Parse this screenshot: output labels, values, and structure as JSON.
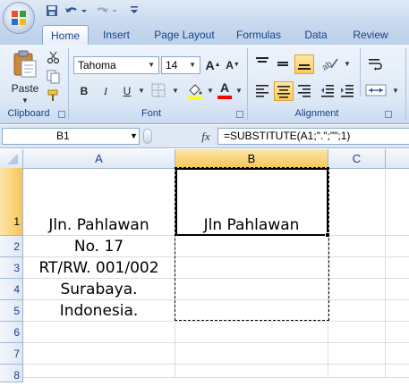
{
  "qat": {
    "save_icon": "save-icon",
    "undo_icon": "undo-icon",
    "redo_icon": "redo-icon"
  },
  "tabs": [
    {
      "label": "Home",
      "active": true
    },
    {
      "label": "Insert",
      "active": false
    },
    {
      "label": "Page Layout",
      "active": false
    },
    {
      "label": "Formulas",
      "active": false
    },
    {
      "label": "Data",
      "active": false
    },
    {
      "label": "Review",
      "active": false
    }
  ],
  "ribbon": {
    "clipboard": {
      "paste_label": "Paste",
      "group_label": "Clipboard"
    },
    "font": {
      "font_name": "Tahoma",
      "font_size": "14",
      "grow_label": "A",
      "shrink_label": "A",
      "bold": "B",
      "italic": "I",
      "underline": "U",
      "font_color_label": "A",
      "group_label": "Font",
      "fill_color": "#ffff00",
      "font_color": "#ff0000"
    },
    "alignment": {
      "group_label": "Alignment"
    }
  },
  "formula_bar": {
    "name_box": "B1",
    "fx_label": "fx",
    "formula": "=SUBSTITUTE(A1;\".\";\"\";1)"
  },
  "grid": {
    "columns": [
      "A",
      "B",
      "C"
    ],
    "selected_column": "B",
    "rows": [
      "1",
      "2",
      "3",
      "4",
      "5",
      "6",
      "7",
      "8"
    ],
    "selected_row": "1",
    "cells": {
      "A1": "Jln. Pahlawan",
      "A2": "No. 17",
      "A3": "RT/RW. 001/002",
      "A4": "Surabaya.",
      "A5": "Indonesia.",
      "B1": "Jln Pahlawan"
    }
  },
  "colors": {
    "accent": "#15428b",
    "selected_header": "#f7c55a"
  }
}
